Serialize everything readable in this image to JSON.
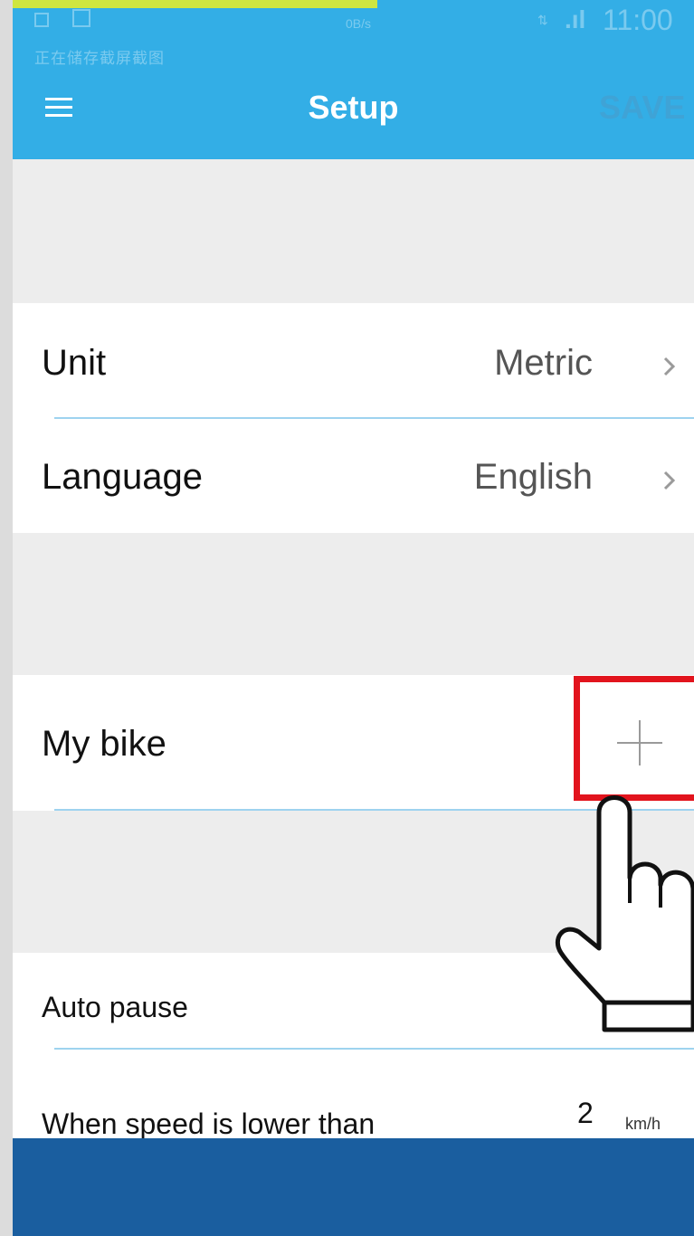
{
  "status_bar": {
    "net_speed": "0B/s",
    "time": "11:00",
    "notification_text": "正在储存截屏截图"
  },
  "header": {
    "title": "Setup",
    "save_label": "SAVE"
  },
  "settings": {
    "unit": {
      "label": "Unit",
      "value": "Metric"
    },
    "language": {
      "label": "Language",
      "value": "English"
    }
  },
  "bike": {
    "label": "My bike"
  },
  "auto_pause": {
    "label": "Auto pause",
    "speed_label": "When speed is lower than",
    "speed_value": "2",
    "speed_unit": "km/h"
  },
  "colors": {
    "appbar": "#33aee6",
    "divider": "#9ed3ef",
    "highlight": "#e2141d",
    "bottom_bar": "#1a5e9f"
  }
}
